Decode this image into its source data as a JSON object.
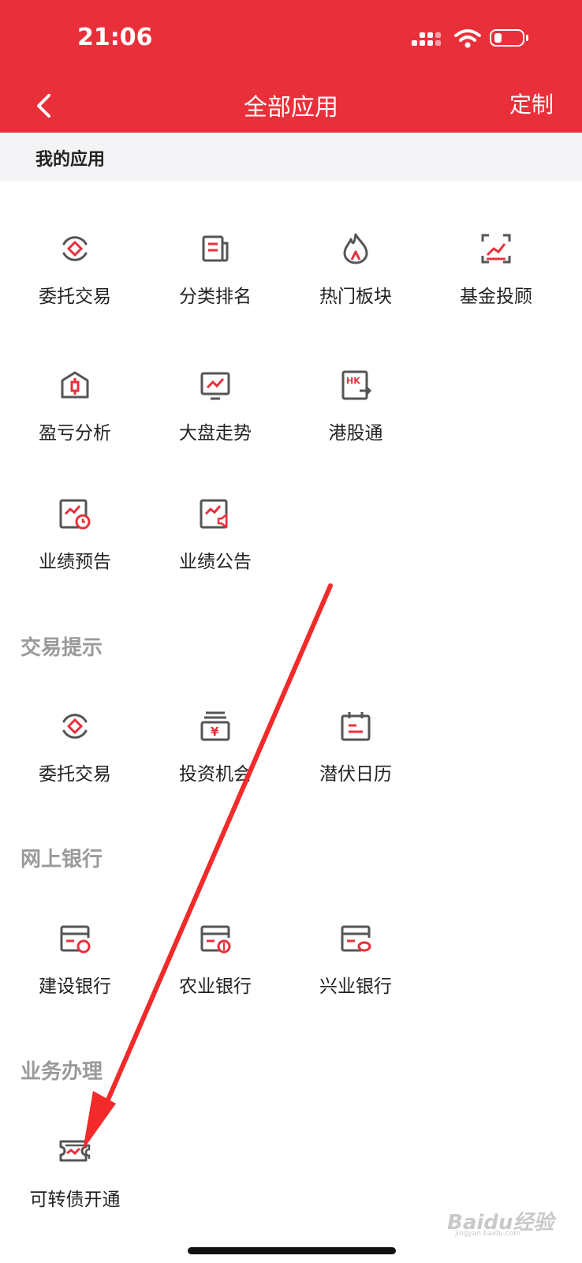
{
  "status_bar": {
    "time": "21:06"
  },
  "nav": {
    "title": "全部应用",
    "customize_label": "定制"
  },
  "sections": [
    {
      "title": "我的应用",
      "apps": [
        "委托交易",
        "分类排名",
        "热门板块",
        "基金投顾",
        "盈亏分析",
        "大盘走势",
        "港股通",
        "业绩预告",
        "业绩公告"
      ]
    },
    {
      "title": "交易提示",
      "apps": [
        "委托交易",
        "投资机会",
        "潜伏日历"
      ]
    },
    {
      "title": "网上银行",
      "apps": [
        "建设银行",
        "农业银行",
        "兴业银行"
      ]
    },
    {
      "title": "业务办理",
      "apps": [
        "可转债开通"
      ]
    }
  ],
  "watermark": {
    "text": "Baidu经验",
    "sub": "jingyan.baidu.com"
  },
  "colors": {
    "brand_red": "#e9303a",
    "icon_gray": "#555555",
    "section_gray": "#9a9a9a"
  }
}
